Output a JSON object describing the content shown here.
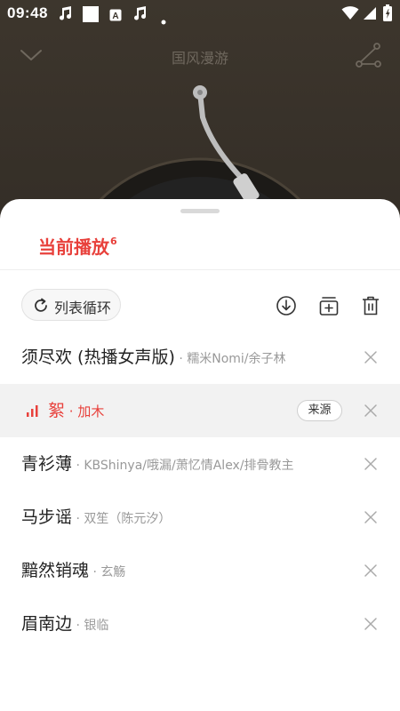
{
  "status_bar": {
    "time": "09:48",
    "left_icons": [
      "music-note-icon",
      "white-square-icon",
      "a-badge-icon",
      "music-note-icon",
      "dot-icon"
    ],
    "right_icons": [
      "wifi-icon",
      "signal-icon",
      "battery-icon"
    ]
  },
  "player": {
    "playlist_title": "国风漫游"
  },
  "queue": {
    "title": "当前播放",
    "count": "6",
    "loop_mode_label": "列表循环",
    "source_label": "来源",
    "accent_color": "#e8413c",
    "songs": [
      {
        "title": "须尽欢 (热播女声版)",
        "artist": " · 糯米Nomi/余子林",
        "playing": false
      },
      {
        "title": "絮",
        "artist": " · 加木",
        "playing": true
      },
      {
        "title": "青衫薄",
        "artist": " · KBShinya/哦漏/萧忆情Alex/排骨教主",
        "playing": false
      },
      {
        "title": "马步谣",
        "artist": " · 双笙（陈元汐）",
        "playing": false
      },
      {
        "title": "黯然销魂",
        "artist": " · 玄觞",
        "playing": false
      },
      {
        "title": "眉南边",
        "artist": " · 银临",
        "playing": false
      }
    ]
  }
}
